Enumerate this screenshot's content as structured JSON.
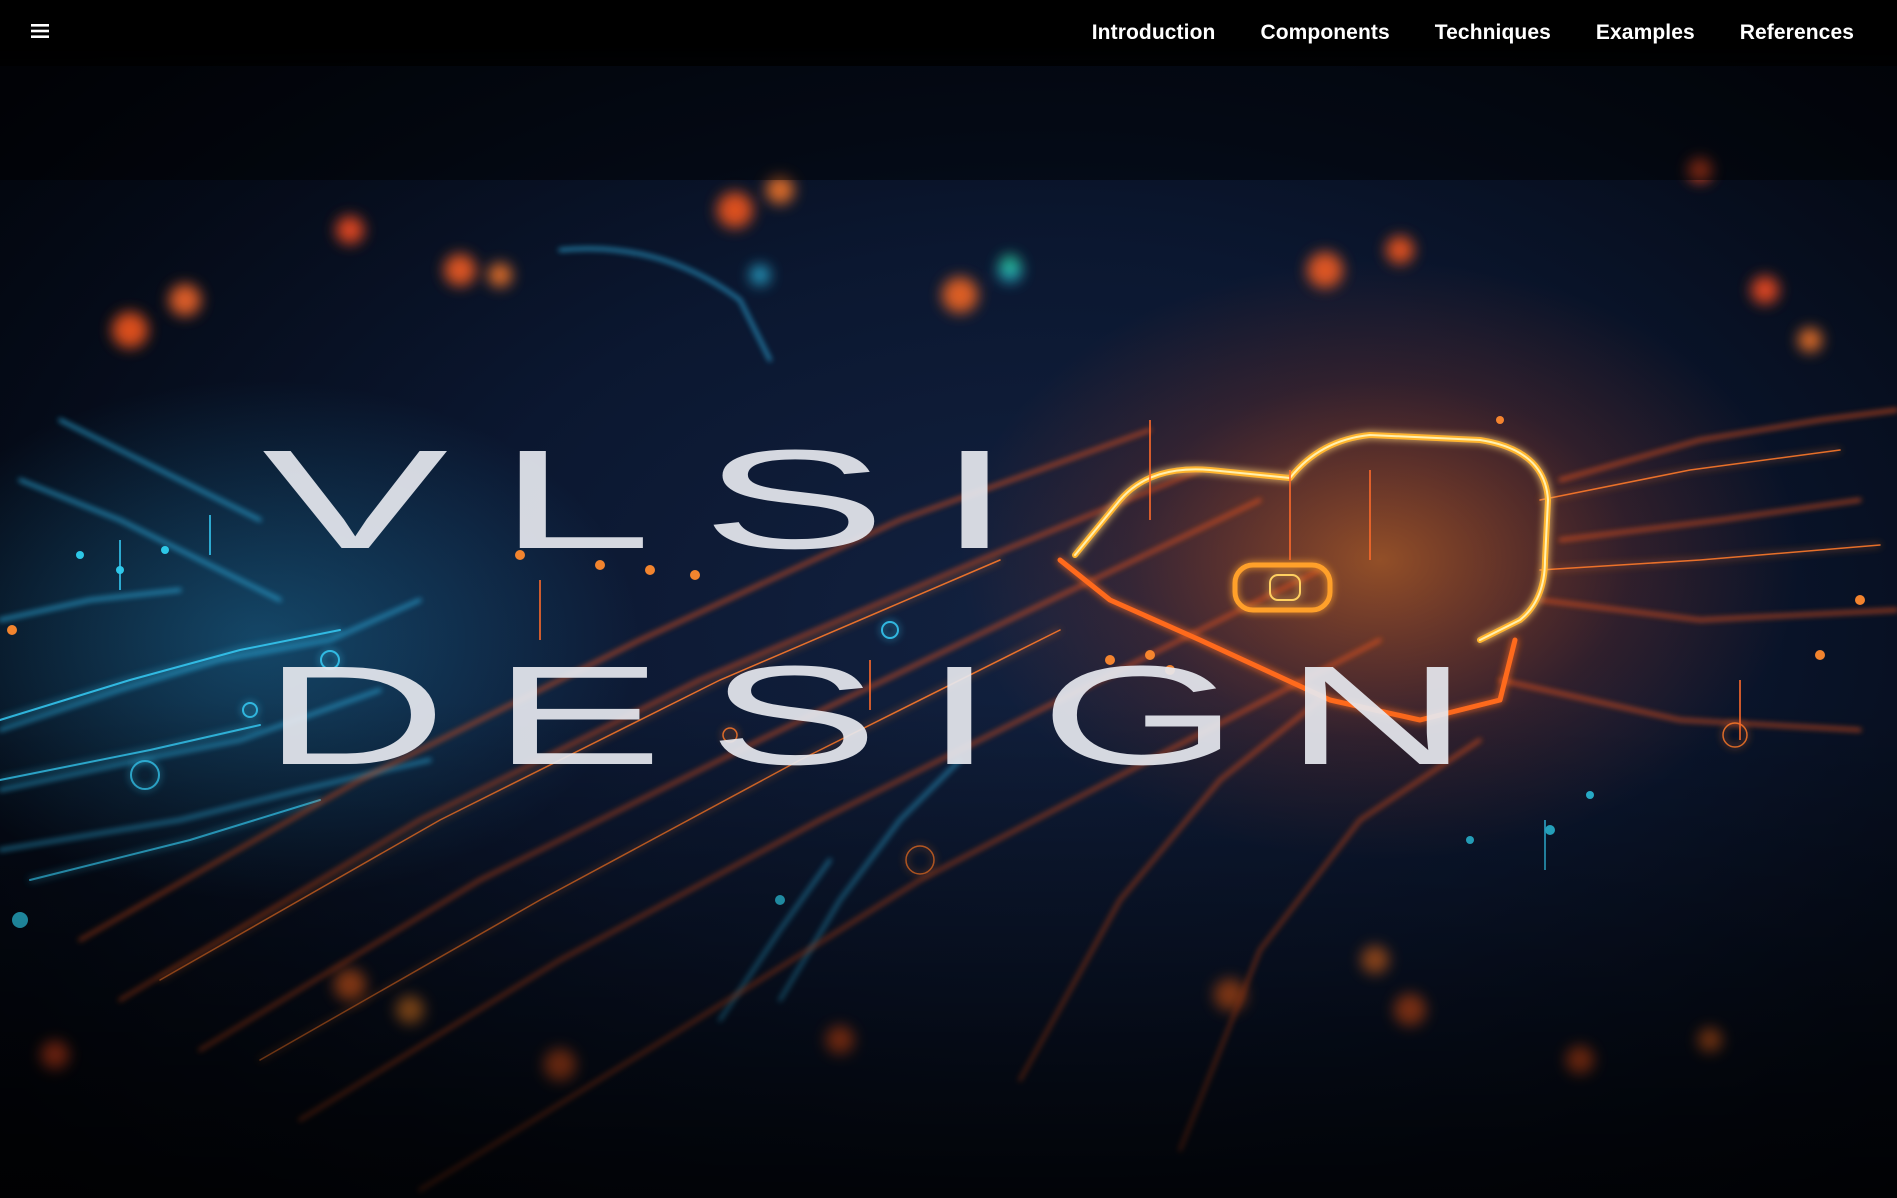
{
  "header": {
    "menu_icon": "hamburger-icon",
    "nav": [
      {
        "label": "Introduction"
      },
      {
        "label": "Components"
      },
      {
        "label": "Techniques"
      },
      {
        "label": "Examples"
      },
      {
        "label": "References"
      }
    ]
  },
  "hero": {
    "title_line_1": "VLSI",
    "title_line_2": "DESIGN",
    "background_image": "circuit-board-with-padlock-illustration"
  },
  "colors": {
    "nav_background": "#000000",
    "nav_text": "#ffffff",
    "title_fill": "#e6e8ef",
    "trace_cyan": "#2fb6e8",
    "trace_orange": "#ff6a1f",
    "glow_yellow": "#ffb52e",
    "background": "#07101f"
  }
}
